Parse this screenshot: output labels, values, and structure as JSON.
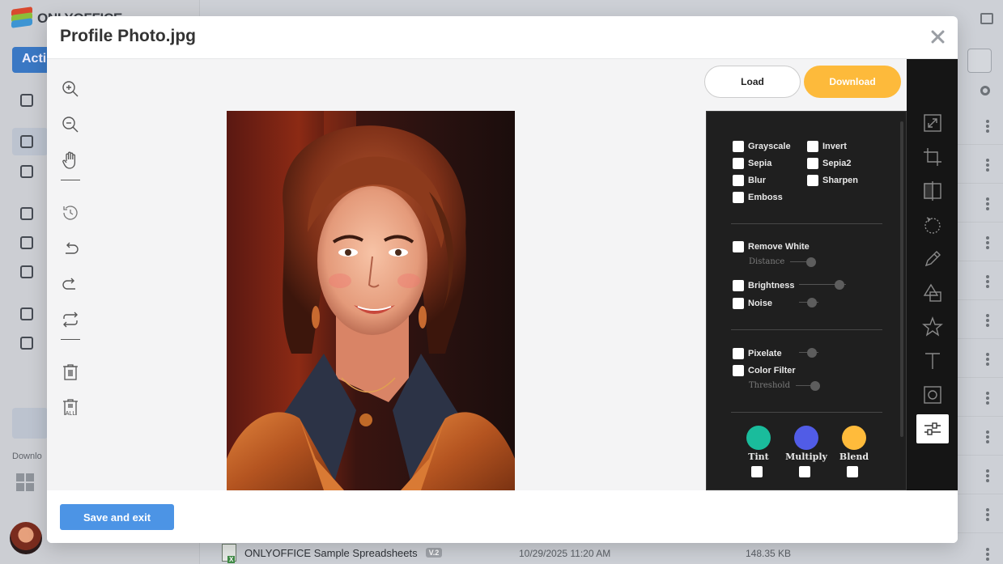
{
  "background": {
    "app_name": "ONLYOFFICE",
    "actions_label": "Acti",
    "downloads_label": "Downlo",
    "file": {
      "name": "ONLYOFFICE Sample Spreadsheets",
      "version": "V.2",
      "date": "10/29/2025 11:20 AM",
      "size": "148.35 KB"
    }
  },
  "modal": {
    "title": "Profile Photo.jpg",
    "load_label": "Load",
    "download_label": "Download",
    "save_label": "Save and exit"
  },
  "filters": {
    "grayscale": "Grayscale",
    "invert": "Invert",
    "sepia": "Sepia",
    "sepia2": "Sepia2",
    "blur": "Blur",
    "sharpen": "Sharpen",
    "emboss": "Emboss",
    "remove_white": "Remove White",
    "distance": "Distance",
    "brightness": "Brightness",
    "noise": "Noise",
    "pixelate": "Pixelate",
    "color_filter": "Color Filter",
    "threshold": "Threshold",
    "tint": "Tint",
    "multiply": "Multiply",
    "blend": "Blend"
  },
  "colors": {
    "tint": "#1abc9c",
    "multiply": "#515ce6",
    "blend": "#ffbb3b",
    "download_button": "#fdba3b",
    "save_button": "#4c94e5"
  },
  "left_tools": [
    "zoom-in-icon",
    "zoom-out-icon",
    "hand-icon",
    "history-icon",
    "undo-icon",
    "redo-icon",
    "reset-icon",
    "delete-icon",
    "delete-all-icon"
  ],
  "right_menu": [
    "resize-icon",
    "crop-icon",
    "flip-icon",
    "rotate-icon",
    "draw-icon",
    "shape-icon",
    "icon-icon",
    "text-icon",
    "mask-icon",
    "filter-icon"
  ],
  "delete_all_label": "ALL"
}
